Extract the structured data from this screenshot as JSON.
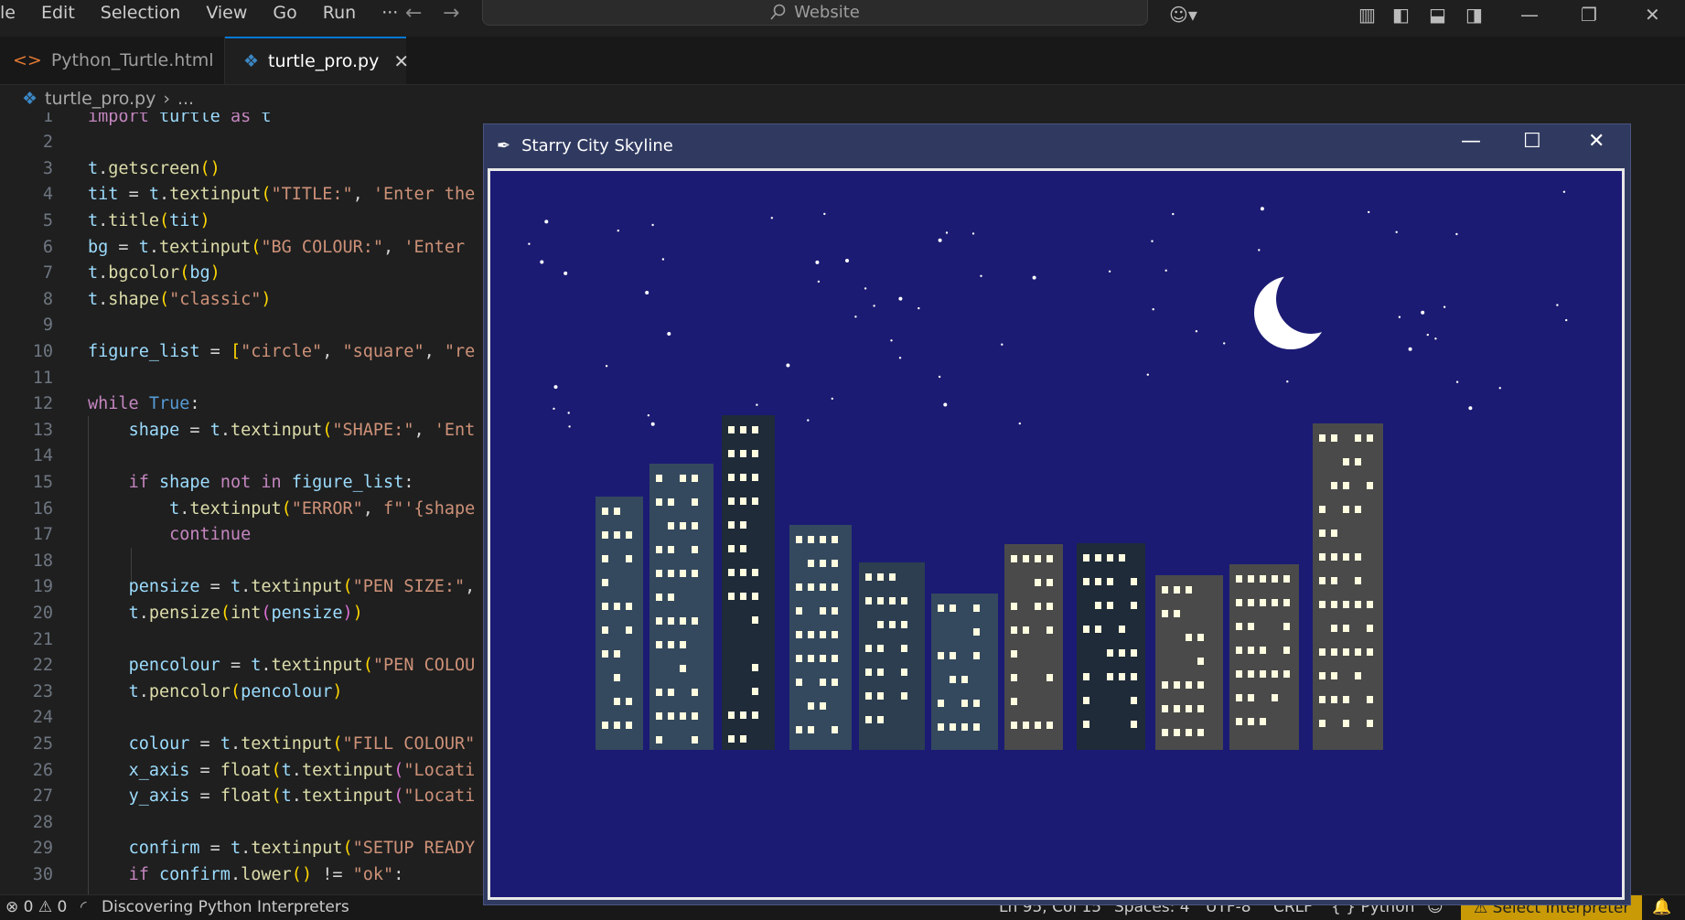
{
  "menu": [
    "le",
    "Edit",
    "Selection",
    "View",
    "Go",
    "Run",
    "···"
  ],
  "command_center": "Website",
  "tabs": [
    {
      "label": "Python_Turtle.html",
      "active": false
    },
    {
      "label": "turtle_pro.py",
      "active": true
    }
  ],
  "breadcrumb": {
    "file": "turtle_pro.py",
    "rest": "..."
  },
  "code_lines": [
    "import turtle as t",
    "",
    "t.getscreen()",
    "tit = t.textinput(\"TITLE:\", 'Enter the",
    "t.title(tit)",
    "bg = t.textinput(\"BG COLOUR:\", 'Enter",
    "t.bgcolor(bg)",
    "t.shape(\"classic\")",
    "",
    "figure_list = [\"circle\", \"square\", \"re",
    "",
    "while True:",
    "    shape = t.textinput(\"SHAPE:\", 'Ent",
    "",
    "    if shape not in figure_list:",
    "        t.textinput(\"ERROR\", f\"'{shape",
    "        continue",
    "",
    "    pensize = t.textinput(\"PEN SIZE:\",",
    "    t.pensize(int(pensize))",
    "",
    "    pencolour = t.textinput(\"PEN COLOU",
    "    t.pencolor(pencolour)",
    "",
    "    colour = t.textinput(\"FILL COLOUR\"",
    "    x_axis = float(t.textinput(\"Locati",
    "    y_axis = float(t.textinput(\"Locati",
    "",
    "    confirm = t.textinput(\"SETUP READY",
    "    if confirm.lower() != \"ok\":"
  ],
  "turtle_window": {
    "title": "Starry City Skyline",
    "sky_color": "#1b1b74",
    "moon_color": "#ffffff",
    "window_light_color": "#fffde0",
    "building_colors": [
      "#34495e",
      "#2c3e50",
      "#1f2b38",
      "#4a4a4a"
    ]
  },
  "status": {
    "problems": "⊗ 0 ⚠ 0",
    "message": "Discovering Python Interpreters",
    "position": "Ln 95, Col 15",
    "spaces": "Spaces: 4",
    "encoding": "UTF-8",
    "eol": "CRLF",
    "language": "{ } Python",
    "interpreter": "⚠ Select Interpreter"
  }
}
